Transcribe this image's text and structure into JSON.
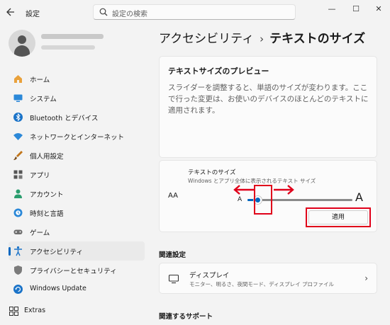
{
  "window": {
    "title": "設定",
    "search_placeholder": "設定の検索",
    "back_icon": "back-arrow-icon",
    "minimize": "—",
    "maximize": "☐",
    "close": "✕"
  },
  "sidebar": {
    "items": [
      {
        "label": "ホーム",
        "icon": "home-icon"
      },
      {
        "label": "システム",
        "icon": "system-icon"
      },
      {
        "label": "Bluetooth とデバイス",
        "icon": "bluetooth-icon"
      },
      {
        "label": "ネットワークとインターネット",
        "icon": "network-icon"
      },
      {
        "label": "個人用設定",
        "icon": "brush-icon"
      },
      {
        "label": "アプリ",
        "icon": "apps-icon"
      },
      {
        "label": "アカウント",
        "icon": "account-icon"
      },
      {
        "label": "時刻と言語",
        "icon": "time-language-icon"
      },
      {
        "label": "ゲーム",
        "icon": "gaming-icon"
      },
      {
        "label": "アクセシビリティ",
        "icon": "accessibility-icon",
        "active": true
      },
      {
        "label": "プライバシーとセキュリティ",
        "icon": "shield-icon"
      },
      {
        "label": "Windows Update",
        "icon": "update-icon"
      }
    ],
    "extras": "Extras"
  },
  "header": {
    "parent": "アクセシビリティ",
    "separator": "›",
    "current": "テキストのサイズ"
  },
  "preview": {
    "title": "テキストサイズのプレビュー",
    "text": "スライダーを調整すると、単語のサイズが変わります。ここで行った変更は、お使いのデバイスのほとんどのテキストに適用されます。"
  },
  "text_size": {
    "label": "テキストのサイズ",
    "description": "Windows とアプリ全体に表示されるテキスト サイズ",
    "icon_text": "AA",
    "min_label": "A",
    "max_label": "A",
    "slider_value": 0.1,
    "apply_label": "適用"
  },
  "related": {
    "title": "関連設定",
    "display": {
      "title": "ディスプレイ",
      "description": "モニター、明るさ、夜間モード、ディスプレイ プロファイル"
    }
  },
  "support": {
    "title": "関連するサポート"
  },
  "colors": {
    "accent": "#0067c0",
    "highlight": "#e0001a"
  }
}
